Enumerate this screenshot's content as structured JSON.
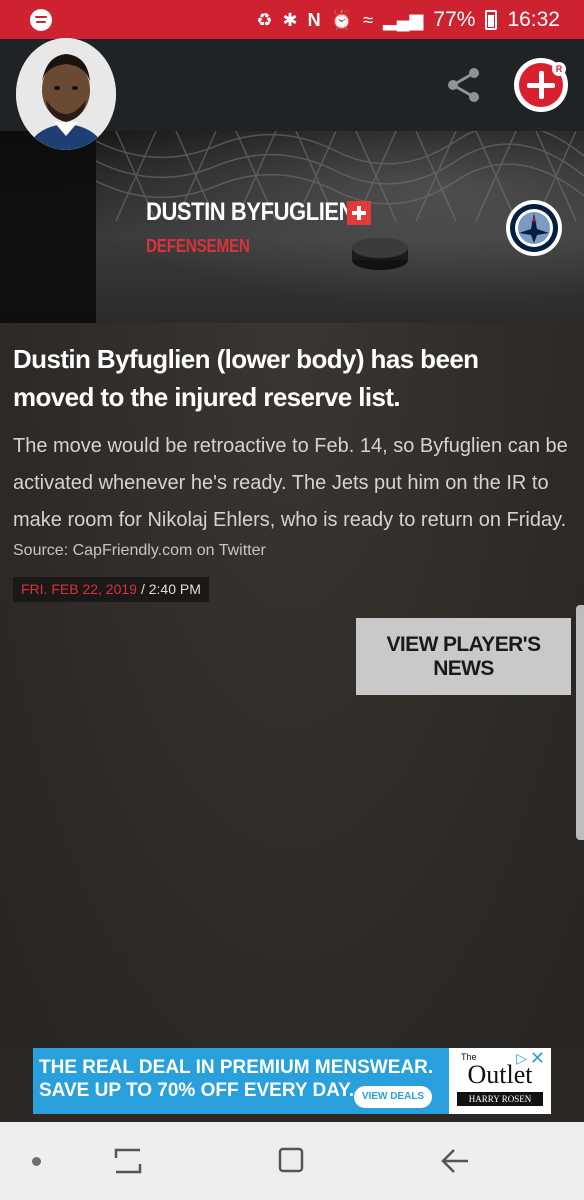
{
  "status_bar": {
    "battery_text": "77%",
    "time": "16:32",
    "icons": [
      "spotify-icon",
      "notification-icon",
      "bluetooth-icon",
      "nfc-icon",
      "alarm-icon",
      "wifi-icon",
      "signal-icon",
      "battery-icon"
    ]
  },
  "app_bar": {
    "back_icon": "back-arrow-icon",
    "share_icon": "share-icon",
    "logo_badge": "R"
  },
  "player": {
    "name": "DUSTIN BYFUGLIEN",
    "position": "DEFENSEMEN",
    "status_icon": "injury-cross-icon",
    "team_logo": "winnipeg-jets-logo"
  },
  "article": {
    "headline": "Dustin Byfuglien (lower body) has been moved to the injured reserve list.",
    "body": "The move would be retroactive to Feb. 14, so Byfuglien can be activated whenever he's ready. The Jets put him on the IR to make room for Nikolaj Ehlers, who is ready to return on Friday.",
    "source": "Source: CapFriendly.com on Twitter",
    "date": "FRI. FEB 22, 2019",
    "time": "/ 2:40 PM"
  },
  "actions": {
    "view_news_label": "VIEW PLAYER'S NEWS"
  },
  "ad": {
    "line1": "THE REAL DEAL IN PREMIUM MENSWEAR.",
    "line2": "SAVE UP TO 70% OFF EVERY DAY.",
    "cta": "VIEW DEALS",
    "brand_the": "The",
    "brand_name": "Outlet",
    "brand_sub": "HARRY ROSEN"
  },
  "colors": {
    "accent_red": "#cf2230",
    "ad_blue": "#29a0db"
  }
}
